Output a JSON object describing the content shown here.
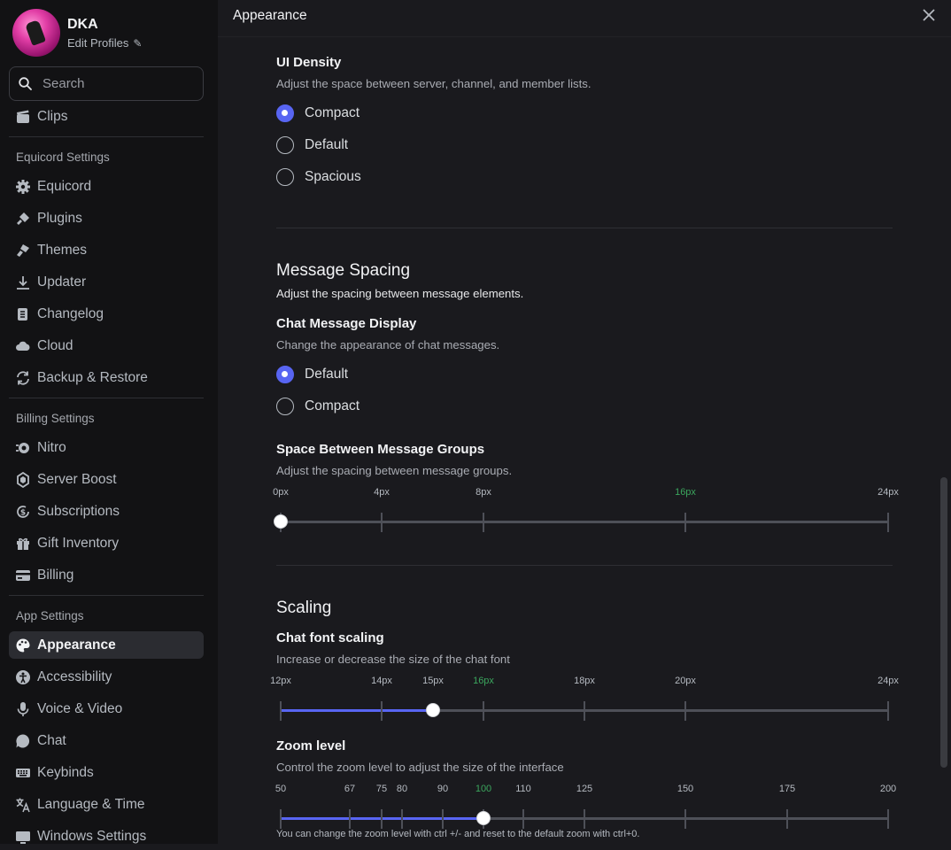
{
  "profile": {
    "name": "DKA",
    "edit_label": "Edit Profiles"
  },
  "search": {
    "placeholder": "Search"
  },
  "sidebar": {
    "top_items": [
      {
        "label": "Clips",
        "icon": "clips-icon"
      }
    ],
    "equicord_header": "Equicord Settings",
    "equicord_items": [
      {
        "label": "Equicord",
        "icon": "gear-icon"
      },
      {
        "label": "Plugins",
        "icon": "plugin-icon"
      },
      {
        "label": "Themes",
        "icon": "paintbrush-icon"
      },
      {
        "label": "Updater",
        "icon": "download-icon"
      },
      {
        "label": "Changelog",
        "icon": "scroll-icon"
      },
      {
        "label": "Cloud",
        "icon": "cloud-icon"
      },
      {
        "label": "Backup & Restore",
        "icon": "refresh-icon"
      }
    ],
    "billing_header": "Billing Settings",
    "billing_items": [
      {
        "label": "Nitro",
        "icon": "nitro-icon"
      },
      {
        "label": "Server Boost",
        "icon": "boost-icon"
      },
      {
        "label": "Subscriptions",
        "icon": "subscriptions-icon"
      },
      {
        "label": "Gift Inventory",
        "icon": "gift-icon"
      },
      {
        "label": "Billing",
        "icon": "card-icon"
      }
    ],
    "app_header": "App Settings",
    "app_items": [
      {
        "label": "Appearance",
        "icon": "palette-icon",
        "active": true
      },
      {
        "label": "Accessibility",
        "icon": "accessibility-icon"
      },
      {
        "label": "Voice & Video",
        "icon": "microphone-icon"
      },
      {
        "label": "Chat",
        "icon": "chat-icon"
      },
      {
        "label": "Keybinds",
        "icon": "keyboard-icon"
      },
      {
        "label": "Language & Time",
        "icon": "language-icon"
      },
      {
        "label": "Windows Settings",
        "icon": "windows-icon"
      }
    ]
  },
  "header": {
    "title": "Appearance"
  },
  "ui_density": {
    "title": "UI Density",
    "description": "Adjust the space between server, channel, and member lists.",
    "options": [
      "Compact",
      "Default",
      "Spacious"
    ],
    "selected": "Compact"
  },
  "message_spacing": {
    "title": "Message Spacing",
    "description": "Adjust the spacing between message elements.",
    "chat_display": {
      "title": "Chat Message Display",
      "description": "Change the appearance of chat messages.",
      "options": [
        "Default",
        "Compact"
      ],
      "selected": "Default"
    },
    "group_space": {
      "title": "Space Between Message Groups",
      "description": "Adjust the spacing between message groups.",
      "ticks": [
        "0px",
        "4px",
        "8px",
        "16px",
        "24px"
      ],
      "default_tick": "16px",
      "value": "0px"
    }
  },
  "scaling": {
    "title": "Scaling",
    "font_scaling": {
      "title": "Chat font scaling",
      "description": "Increase or decrease the size of the chat font",
      "ticks": [
        "12px",
        "14px",
        "15px",
        "16px",
        "18px",
        "20px",
        "24px"
      ],
      "default_tick": "16px",
      "value": "15px"
    },
    "zoom": {
      "title": "Zoom level",
      "description": "Control the zoom level to adjust the size of the interface",
      "ticks": [
        "50",
        "67",
        "75",
        "80",
        "90",
        "100",
        "110",
        "125",
        "150",
        "175",
        "200"
      ],
      "default_tick": "100",
      "value": "100",
      "hint": "You can change the zoom level with ctrl +/- and reset to the default zoom with ctrl+0."
    }
  },
  "colors": {
    "accent": "#5865f2",
    "default_tick": "#3ba55d"
  }
}
